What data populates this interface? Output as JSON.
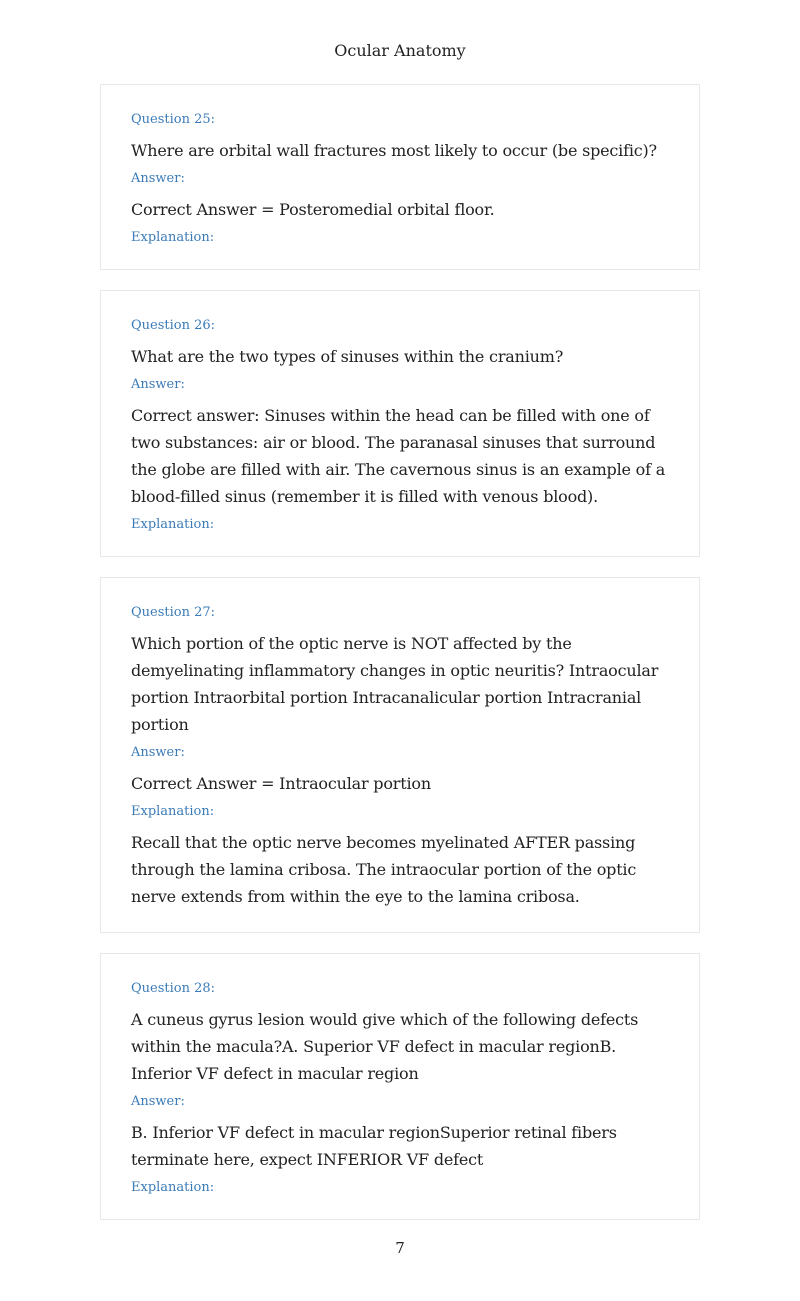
{
  "header": {
    "title": "Ocular Anatomy"
  },
  "labels": {
    "answer": "Answer:",
    "explanation": "Explanation:"
  },
  "questions": [
    {
      "number_label": "Question 25:",
      "question": "Where are orbital wall fractures most likely to occur (be specific)?",
      "answer": "Correct Answer = Posteromedial orbital floor.",
      "explanation": ""
    },
    {
      "number_label": "Question 26:",
      "question": "What are the two types of sinuses within the cranium?",
      "answer": "Correct answer: Sinuses within the head can be filled with one of two substances: air or blood. The paranasal sinuses that surround the globe are filled with air. The cavernous sinus is an example of a blood-filled sinus (remember it is filled with venous blood).",
      "explanation": ""
    },
    {
      "number_label": "Question 27:",
      "question": "Which portion of the optic nerve is NOT affected by the demyelinating inflammatory changes in optic neuritis? Intraocular portion Intraorbital portion Intracanalicular portion Intracranial portion",
      "answer": "Correct Answer = Intraocular portion",
      "explanation": "Recall that the optic nerve becomes myelinated AFTER passing through the lamina cribosa. The intraocular portion of the optic nerve extends from within the eye to the lamina cribosa."
    },
    {
      "number_label": "Question 28:",
      "question": "A cuneus gyrus lesion would give which of the following defects within the macula?A. Superior VF defect in macular regionB. Inferior VF defect in macular region",
      "answer": "B. Inferior VF defect in macular regionSuperior retinal fibers terminate here, expect INFERIOR VF defect",
      "explanation": ""
    }
  ],
  "footer": {
    "page_number": "7"
  }
}
